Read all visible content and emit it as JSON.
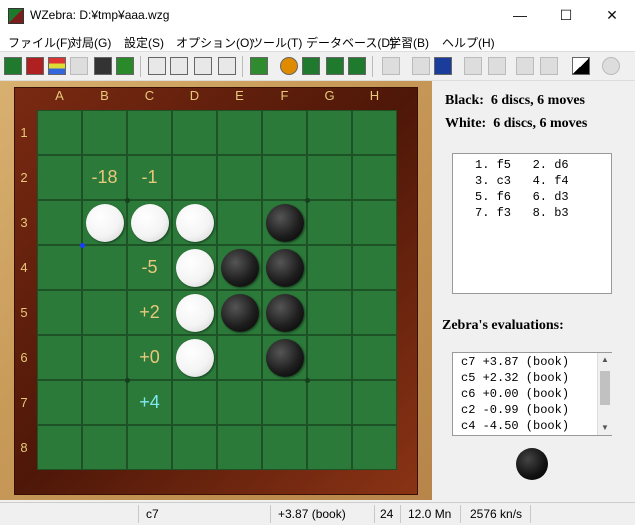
{
  "window": {
    "title": "WZebra: D:¥tmp¥aaa.wzg",
    "minimize": "—",
    "maximize": "☐",
    "close": "✕"
  },
  "menu": [
    {
      "label": "ファイル(F)"
    },
    {
      "label": "対局(G)"
    },
    {
      "label": "設定(S)"
    },
    {
      "label": "オプション(O)"
    },
    {
      "label": "ツール(T)"
    },
    {
      "label": "データベース(D)"
    },
    {
      "label": "学習(B)"
    },
    {
      "label": "ヘルプ(H)"
    }
  ],
  "toolbar_icons": [
    "new-game-icon",
    "book-icon",
    "stack-icon",
    "print-icon",
    "save-icon",
    "open-folder-icon",
    "swap-icon",
    "engine-play-icon",
    "engine-think-icon",
    "zz-icon",
    "download-icon",
    "stop-icon",
    "board-icon",
    "board-flip-icon",
    "refresh-icon",
    "hint-icon",
    "first-move-icon",
    "prev-move-icon",
    "down-icon",
    "bulb-icon",
    "next-move-icon",
    "last-move-icon",
    "color-toggle-icon",
    "settings-disk-icon"
  ],
  "board": {
    "columns": [
      "A",
      "B",
      "C",
      "D",
      "E",
      "F",
      "G",
      "H"
    ],
    "rows": [
      "1",
      "2",
      "3",
      "4",
      "5",
      "6",
      "7",
      "8"
    ],
    "discs": [
      {
        "cell": "B3",
        "color": "white"
      },
      {
        "cell": "C3",
        "color": "white"
      },
      {
        "cell": "D3",
        "color": "white"
      },
      {
        "cell": "F3",
        "color": "black"
      },
      {
        "cell": "D4",
        "color": "white"
      },
      {
        "cell": "E4",
        "color": "black"
      },
      {
        "cell": "F4",
        "color": "black"
      },
      {
        "cell": "D5",
        "color": "white"
      },
      {
        "cell": "E5",
        "color": "black"
      },
      {
        "cell": "F5",
        "color": "black"
      },
      {
        "cell": "D6",
        "color": "white"
      },
      {
        "cell": "F6",
        "color": "black"
      }
    ],
    "evals": [
      {
        "cell": "B2",
        "text": "-18",
        "best": false
      },
      {
        "cell": "C2",
        "text": "-1",
        "best": false
      },
      {
        "cell": "C4",
        "text": "-5",
        "best": false
      },
      {
        "cell": "C5",
        "text": "+2",
        "best": false
      },
      {
        "cell": "C6",
        "text": "+0",
        "best": false
      },
      {
        "cell": "C7",
        "text": "+4",
        "best": true
      }
    ],
    "last_move": "B3"
  },
  "status": {
    "black_label": "Black:",
    "black_value": "6 discs, 6 moves",
    "white_label": "White:",
    "white_value": "6 discs, 6 moves"
  },
  "moves": [
    "1. f5   2. d6",
    "3. c3   4. f4",
    "5. f6   6. d3",
    "7. f3   8. b3"
  ],
  "evaluations_title": "Zebra's evaluations:",
  "evaluations": [
    "c7 +3.87 (book)",
    "c5 +2.32 (book)",
    "c6 +0.00 (book)",
    "c2 -0.99 (book)",
    "c4 -4.50 (book)"
  ],
  "side_to_move": "black",
  "statusbar": {
    "move": "c7",
    "eval": "+3.87 (book)",
    "depth": "24",
    "nodes": "12.0 Mn",
    "speed": "2576 kn/s"
  }
}
